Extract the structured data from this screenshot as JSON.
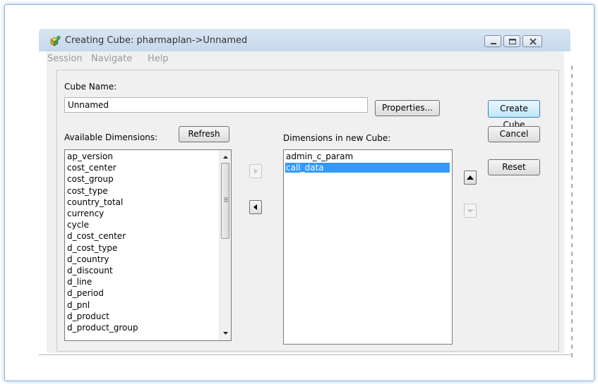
{
  "window": {
    "title": "Creating Cube: pharmaplan->Unnamed",
    "menu": [
      "Session",
      "Navigate",
      "Help"
    ]
  },
  "cube_name": {
    "label": "Cube Name:",
    "value": "Unnamed"
  },
  "buttons": {
    "properties": "Properties...",
    "create_cube": "Create Cube",
    "cancel": "Cancel",
    "reset": "Reset",
    "refresh": "Refresh"
  },
  "available": {
    "label": "Available Dimensions:",
    "items": [
      "ap_version",
      "cost_center",
      "cost_group",
      "cost_type",
      "country_total",
      "currency",
      "cycle",
      "d_cost_center",
      "d_cost_type",
      "d_country",
      "d_discount",
      "d_line",
      "d_period",
      "d_pnl",
      "d_product",
      "d_product_group"
    ]
  },
  "in_cube": {
    "label": "Dimensions in new Cube:",
    "items": [
      "admin_c_param",
      "call_data"
    ],
    "selected_index": 1
  },
  "colors": {
    "selection": "#3399ff",
    "title_gradient_top": "#d9e6f4",
    "frame_glow": "#9fc3e9"
  },
  "icons": {
    "app": "cube-app-icon",
    "move_right": "chevron-right-icon",
    "move_left": "chevron-left-icon",
    "move_up": "chevron-up-icon",
    "move_down": "chevron-down-icon"
  }
}
